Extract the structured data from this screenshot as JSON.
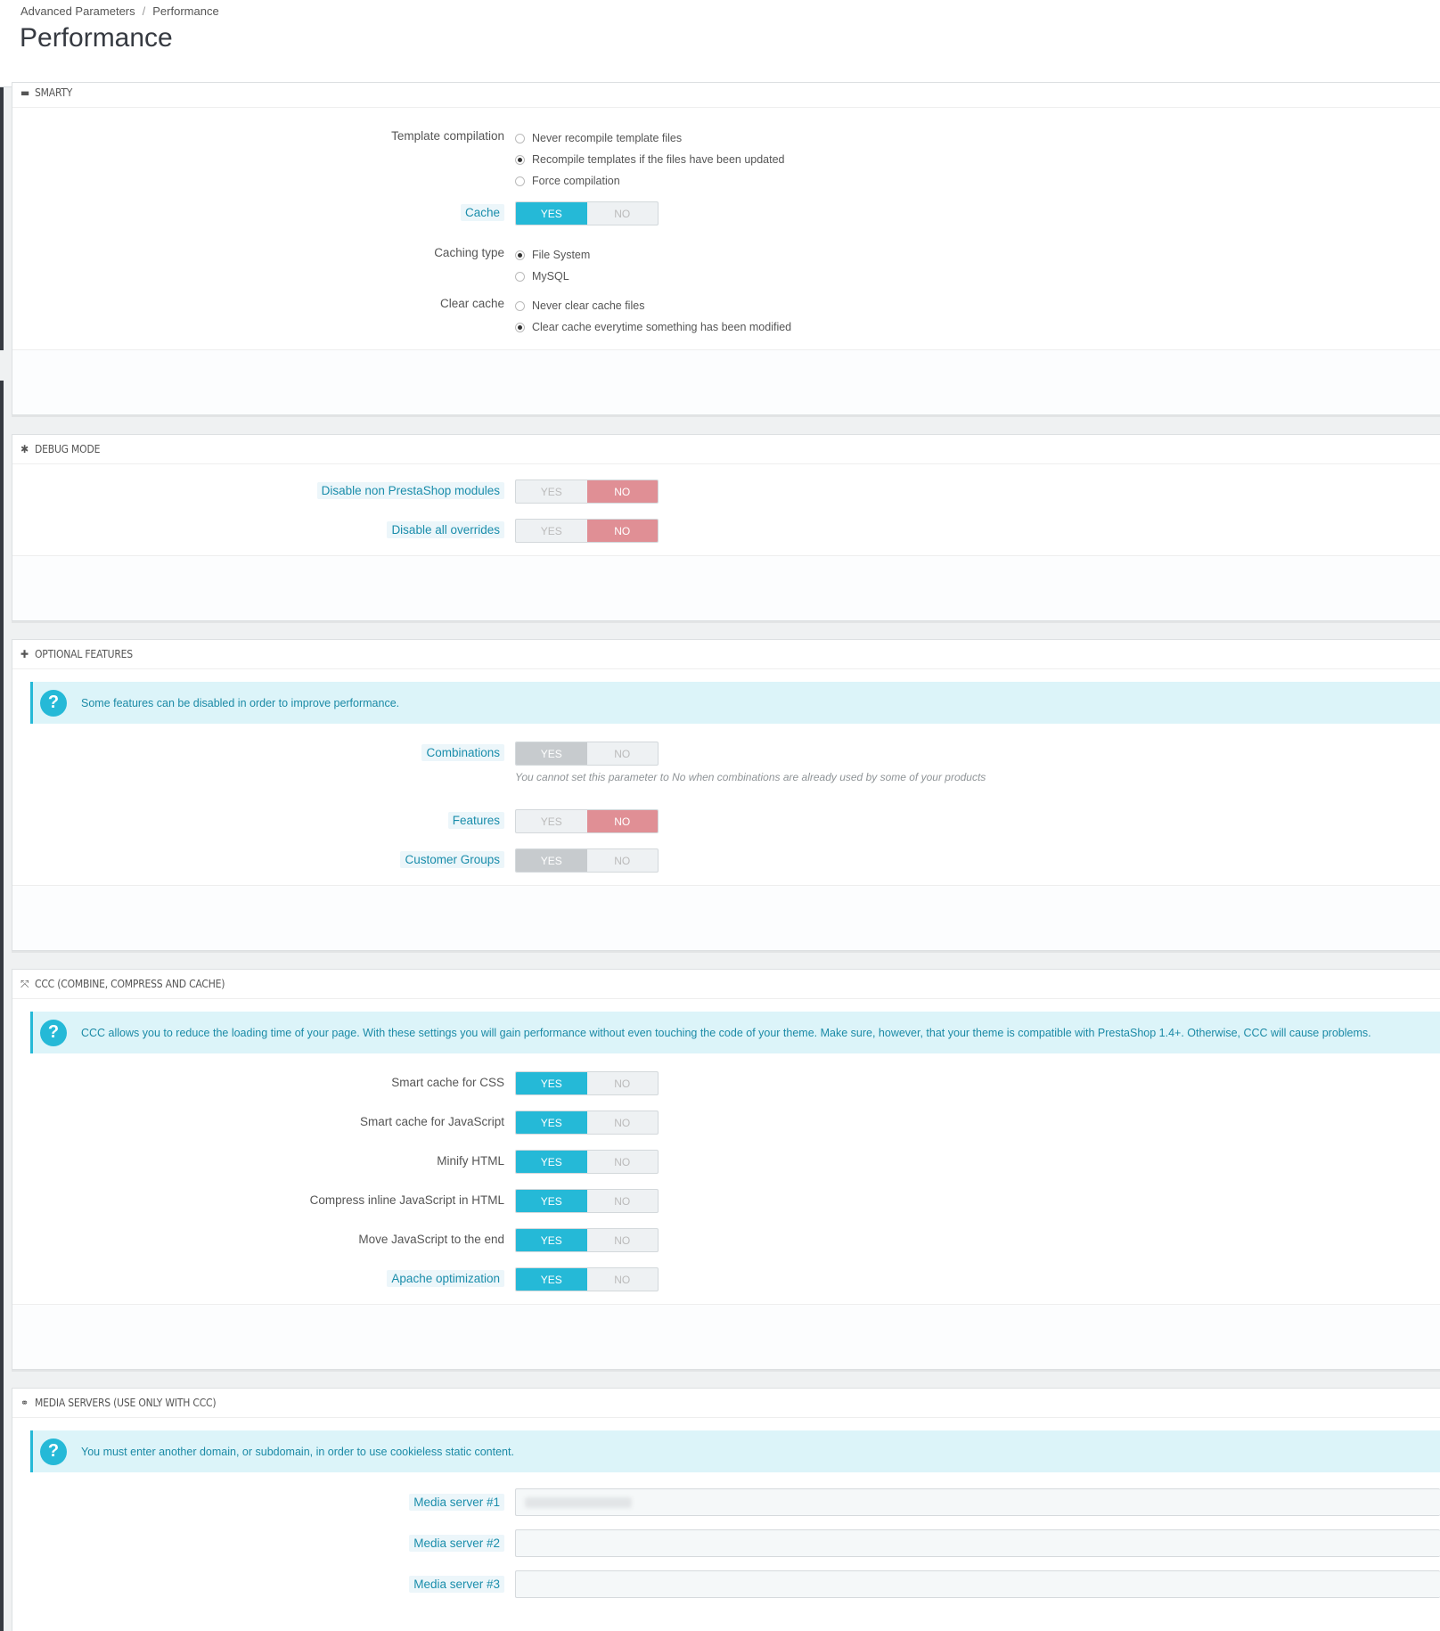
{
  "breadcrumb": {
    "parent": "Advanced Parameters",
    "separator": "/",
    "current": "Performance"
  },
  "page_title": "Performance",
  "smarty": {
    "heading": "SMARTY",
    "template_compilation": {
      "label": "Template compilation",
      "options": [
        "Never recompile template files",
        "Recompile templates if the files have been updated",
        "Force compilation"
      ],
      "selected": 1
    },
    "cache": {
      "label": "Cache",
      "yes": "YES",
      "no": "NO",
      "value": "YES"
    },
    "caching_type": {
      "label": "Caching type",
      "options": [
        "File System",
        "MySQL"
      ],
      "selected": 0
    },
    "clear_cache": {
      "label": "Clear cache",
      "options": [
        "Never clear cache files",
        "Clear cache everytime something has been modified"
      ],
      "selected": 1
    }
  },
  "debug": {
    "heading": "DEBUG MODE",
    "disable_modules": {
      "label": "Disable non PrestaShop modules",
      "yes": "YES",
      "no": "NO",
      "value": "NO"
    },
    "disable_overrides": {
      "label": "Disable all overrides",
      "yes": "YES",
      "no": "NO",
      "value": "NO"
    }
  },
  "optional": {
    "heading": "OPTIONAL FEATURES",
    "alert": "Some features can be disabled in order to improve performance.",
    "combinations": {
      "label": "Combinations",
      "yes": "YES",
      "no": "NO",
      "value": "YES",
      "disabled": true,
      "help": "You cannot set this parameter to No when combinations are already used by some of your products"
    },
    "features": {
      "label": "Features",
      "yes": "YES",
      "no": "NO",
      "value": "NO"
    },
    "customer_groups": {
      "label": "Customer Groups",
      "yes": "YES",
      "no": "NO",
      "value": "YES",
      "disabled": true
    }
  },
  "ccc": {
    "heading": "CCC (COMBINE, COMPRESS AND CACHE)",
    "alert": "CCC allows you to reduce the loading time of your page. With these settings you will gain performance without even touching the code of your theme. Make sure, however, that your theme is compatible with PrestaShop 1.4+. Otherwise, CCC will cause problems.",
    "settings": [
      {
        "label": "Smart cache for CSS",
        "yes": "YES",
        "no": "NO",
        "value": "YES"
      },
      {
        "label": "Smart cache for JavaScript",
        "yes": "YES",
        "no": "NO",
        "value": "YES"
      },
      {
        "label": "Minify HTML",
        "yes": "YES",
        "no": "NO",
        "value": "YES"
      },
      {
        "label": "Compress inline JavaScript in HTML",
        "yes": "YES",
        "no": "NO",
        "value": "YES"
      },
      {
        "label": "Move JavaScript to the end",
        "yes": "YES",
        "no": "NO",
        "value": "YES"
      },
      {
        "label": "Apache optimization",
        "yes": "YES",
        "no": "NO",
        "value": "YES"
      }
    ]
  },
  "media": {
    "heading": "MEDIA SERVERS (USE ONLY WITH CCC)",
    "alert": "You must enter another domain, or subdomain, in order to use cookieless static content.",
    "server1": {
      "label": "Media server #1",
      "value": ""
    },
    "server2": {
      "label": "Media server #2",
      "value": ""
    },
    "server3": {
      "label": "Media server #3",
      "value": ""
    }
  }
}
